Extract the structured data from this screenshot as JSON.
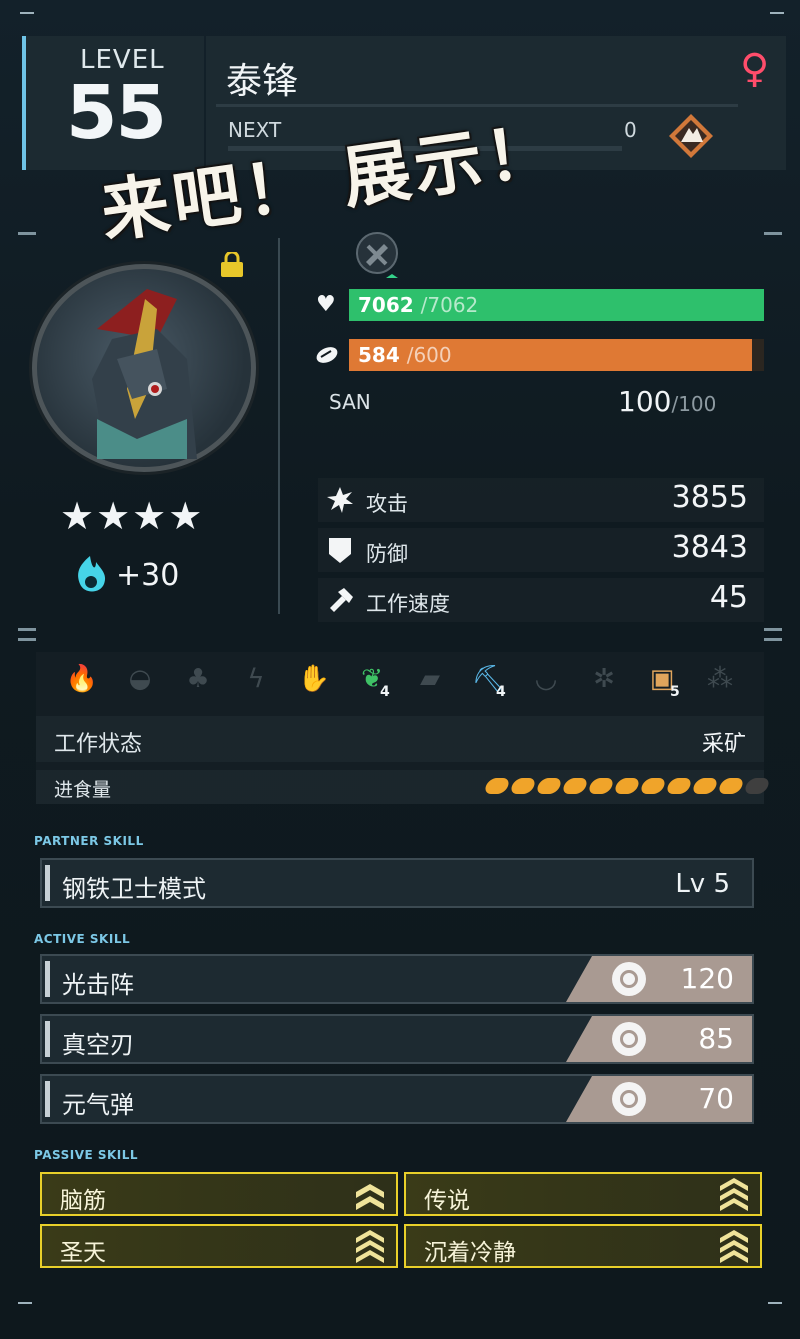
{
  "header": {
    "level_label": "LEVEL",
    "level": "55",
    "name": "泰锋",
    "gender_symbol": "♀",
    "next_label": "NEXT",
    "next_value": "0"
  },
  "overlay_text": "来吧！ 展示！",
  "profile": {
    "stars": "★★★★",
    "soul_bonus": "+30"
  },
  "vitals": {
    "hp_current": "7062",
    "hp_max": "/7062",
    "food_current": "584",
    "food_max": "/600",
    "san_label": "SAN",
    "san_current": "100",
    "san_max": "/100"
  },
  "stats": [
    {
      "label": "攻击",
      "value": "3855"
    },
    {
      "label": "防御",
      "value": "3843"
    },
    {
      "label": "工作速度",
      "value": "45"
    }
  ],
  "work": {
    "icons": [
      "kindling-icon",
      "watering-icon",
      "planting-icon",
      "electricity-icon",
      "handiwork-icon",
      "gathering-icon",
      "lumbering-icon",
      "mining-icon",
      "medicine-icon",
      "cooling-icon",
      "transporting-icon",
      "farming-icon"
    ],
    "levels": {
      "gathering": "4",
      "mining": "4",
      "transporting": "5"
    },
    "status_label": "工作状态",
    "status_value": "采矿",
    "food_label": "进食量",
    "food_filled": 10,
    "food_total": 11
  },
  "partner_skill": {
    "section_label": "PARTNER SKILL",
    "name": "钢铁卫士模式",
    "level": "Lv  5"
  },
  "active_skills": {
    "section_label": "ACTIVE SKILL",
    "items": [
      {
        "name": "光击阵",
        "cost": "120"
      },
      {
        "name": "真空刃",
        "cost": "85"
      },
      {
        "name": "元气弹",
        "cost": "70"
      }
    ]
  },
  "passive_skills": {
    "section_label": "PASSIVE SKILL",
    "items": [
      "脑筋",
      "传说",
      "圣天",
      "沉着冷静"
    ]
  },
  "colors": {
    "hp": "#2ec06c",
    "food": "#df7934",
    "accent": "#6fc3e6",
    "passive_border": "#e9d02a",
    "gender": "#ff4d6b"
  }
}
